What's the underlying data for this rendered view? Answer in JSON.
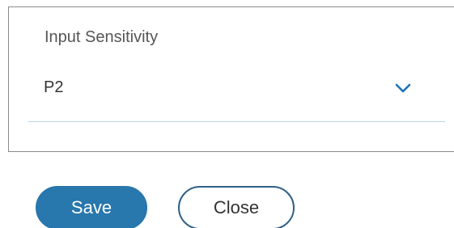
{
  "form": {
    "field_label": "Input Sensitivity",
    "selected_value": "P2",
    "chevron_icon": "chevron-down-icon",
    "accent_color": "#1a73b8"
  },
  "actions": {
    "save_label": "Save",
    "close_label": "Close",
    "save_color": "#2877ad"
  }
}
